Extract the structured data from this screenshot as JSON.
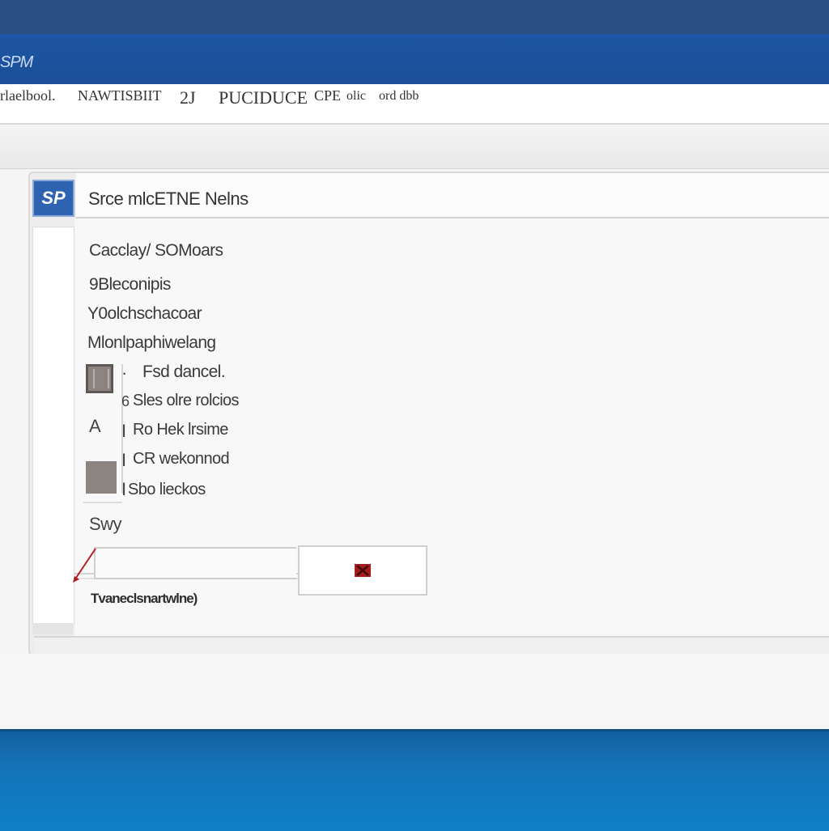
{
  "app": {
    "title": "SPM"
  },
  "menu": {
    "items": [
      "rlaelbool.",
      "NAWTISBIIT",
      "2J",
      "PUCIDUCE",
      "CPE",
      "olic",
      "ord dbb"
    ]
  },
  "panel": {
    "header_icon_text": "SP",
    "header_title": "Srce mlcETNE Nelns"
  },
  "options": [
    {
      "prefix": "",
      "label": "Cacclay/ SOMoars"
    },
    {
      "prefix": "",
      "label": "9Bleconipis"
    },
    {
      "prefix": "",
      "label": "Y0olchschacoar"
    },
    {
      "prefix": "",
      "label": "Mlonlpaphiwelang"
    },
    {
      "prefix": "",
      "label": "Fsd dancel."
    },
    {
      "prefix": "",
      "label": "Sles olre rolcios"
    },
    {
      "prefix": "",
      "label": "Ro Hek lrsime"
    },
    {
      "prefix": "",
      "label": "CR wekonnod"
    },
    {
      "prefix": "",
      "label": "Sbo lieckos"
    }
  ],
  "glyphs": {
    "item5_prefix": "·",
    "item6_prefix": "6",
    "item7_prefix": "A",
    "item7_bar": "I",
    "item8_bar": "I",
    "item9_bar": "I"
  },
  "form": {
    "section_label": "Swy",
    "input_value": "",
    "input_placeholder": "",
    "button_icon": "delete-icon",
    "hint": "Tvaneclsnartwlne)"
  },
  "colors": {
    "titlebar": "#1d56a4",
    "taskbar": "#1471b5",
    "accent_red": "#b02020"
  }
}
